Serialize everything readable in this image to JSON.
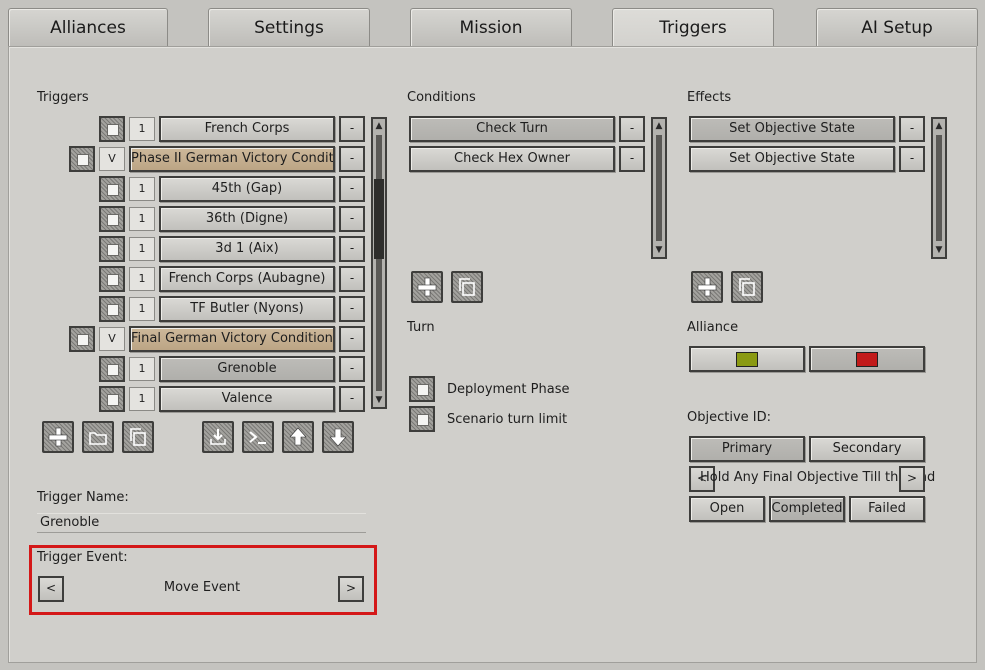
{
  "tabs": [
    "Alliances",
    "Settings",
    "Mission",
    "Triggers",
    "AI Setup"
  ],
  "triggers": {
    "heading": "Triggers",
    "rows": [
      {
        "num": "1",
        "name": "French Corps",
        "minus": "-"
      },
      {
        "num": "V",
        "name": "Phase II German Victory Conditions",
        "minus": "-"
      },
      {
        "num": "1",
        "name": "45th (Gap)",
        "minus": "-"
      },
      {
        "num": "1",
        "name": "36th (Digne)",
        "minus": "-"
      },
      {
        "num": "1",
        "name": "3d 1 (Aix)",
        "minus": "-"
      },
      {
        "num": "1",
        "name": "French Corps (Aubagne)",
        "minus": "-"
      },
      {
        "num": "1",
        "name": "TF Butler (Nyons)",
        "minus": "-"
      },
      {
        "num": "V",
        "name": "Final German Victory Conditions",
        "minus": "-"
      },
      {
        "num": "1",
        "name": "Grenoble",
        "minus": "-"
      },
      {
        "num": "1",
        "name": "Valence",
        "minus": "-"
      }
    ],
    "name_label": "Trigger Name:",
    "name_value": "Grenoble",
    "event_label": "Trigger Event:",
    "event_value": "Move Event",
    "prev": "<",
    "next": ">"
  },
  "conditions": {
    "heading": "Conditions",
    "items": [
      "Check Turn",
      "Check Hex Owner"
    ],
    "minus": "-"
  },
  "turn": {
    "heading": "Turn",
    "options": [
      "Deployment Phase",
      "Scenario turn limit"
    ]
  },
  "effects": {
    "heading": "Effects",
    "items": [
      "Set Objective State",
      "Set Objective State"
    ],
    "minus": "-"
  },
  "alliance": {
    "heading": "Alliance",
    "colors": [
      "#8a9a12",
      "#c21a1a"
    ]
  },
  "objective": {
    "heading": "Objective ID:",
    "primary": "Primary",
    "secondary": "Secondary",
    "name": "Hold Any Final Objective Till the End",
    "prev": "<",
    "next": ">",
    "states": [
      "Open",
      "Completed",
      "Failed"
    ]
  }
}
